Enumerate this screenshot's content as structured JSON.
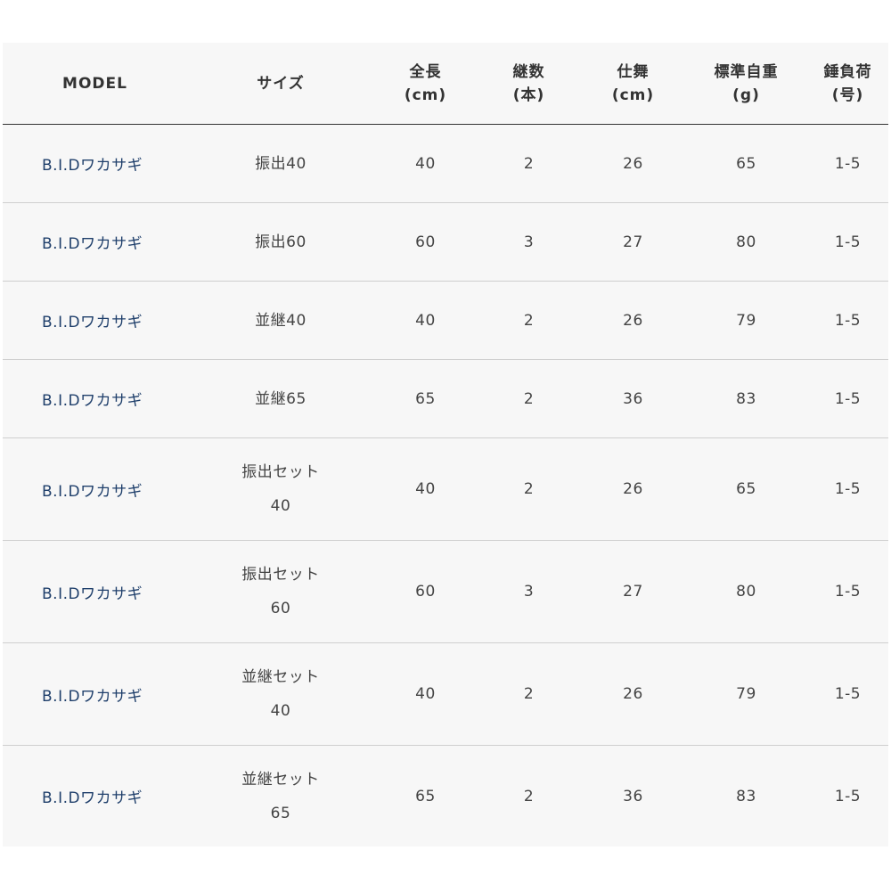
{
  "headers": {
    "model": [
      "MODEL"
    ],
    "size": [
      "サイズ"
    ],
    "length": [
      "全長",
      "(cm)"
    ],
    "sections": [
      "継数",
      "(本)"
    ],
    "closed": [
      "仕舞",
      "(cm)"
    ],
    "weight": [
      "標準自重",
      "(g)"
    ],
    "lure": [
      "錘負荷",
      "(号)"
    ]
  },
  "rows": [
    {
      "model": "B.I.Dワカサギ",
      "size": [
        "振出40"
      ],
      "length": "40",
      "sections": "2",
      "closed": "26",
      "weight": "65",
      "lure": "1-5"
    },
    {
      "model": "B.I.Dワカサギ",
      "size": [
        "振出60"
      ],
      "length": "60",
      "sections": "3",
      "closed": "27",
      "weight": "80",
      "lure": "1-5"
    },
    {
      "model": "B.I.Dワカサギ",
      "size": [
        "並継40"
      ],
      "length": "40",
      "sections": "2",
      "closed": "26",
      "weight": "79",
      "lure": "1-5"
    },
    {
      "model": "B.I.Dワカサギ",
      "size": [
        "並継65"
      ],
      "length": "65",
      "sections": "2",
      "closed": "36",
      "weight": "83",
      "lure": "1-5"
    },
    {
      "model": "B.I.Dワカサギ",
      "size": [
        "振出セット",
        "40"
      ],
      "length": "40",
      "sections": "2",
      "closed": "26",
      "weight": "65",
      "lure": "1-5"
    },
    {
      "model": "B.I.Dワカサギ",
      "size": [
        "振出セット",
        "60"
      ],
      "length": "60",
      "sections": "3",
      "closed": "27",
      "weight": "80",
      "lure": "1-5"
    },
    {
      "model": "B.I.Dワカサギ",
      "size": [
        "並継セット",
        "40"
      ],
      "length": "40",
      "sections": "2",
      "closed": "26",
      "weight": "79",
      "lure": "1-5"
    },
    {
      "model": "B.I.Dワカサギ",
      "size": [
        "並継セット",
        "65"
      ],
      "length": "65",
      "sections": "2",
      "closed": "36",
      "weight": "83",
      "lure": "1-5"
    }
  ]
}
